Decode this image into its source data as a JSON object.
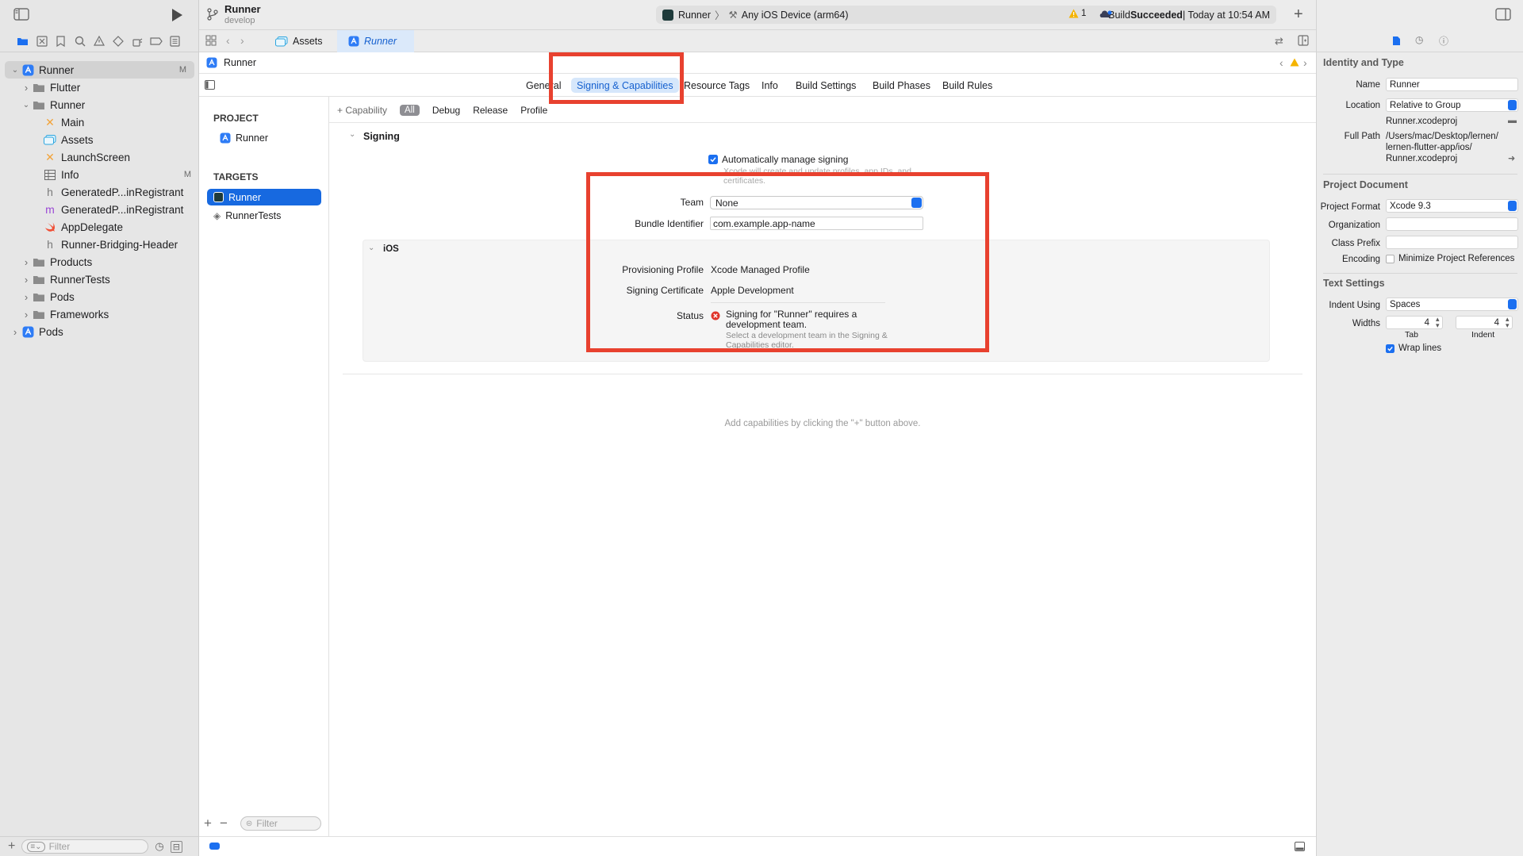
{
  "toolbar": {
    "project_name": "Runner",
    "branch": "develop",
    "scheme": "Runner",
    "device": "Any iOS Device (arm64)",
    "build_prefix": "Build ",
    "build_status": "Succeeded",
    "build_time": " | Today at 10:54 AM",
    "warning_count": "1"
  },
  "tabs": {
    "assets": "Assets",
    "runner": "Runner"
  },
  "jumpbar": {
    "item": "Runner"
  },
  "navigator": {
    "items": [
      {
        "label": "Runner",
        "level": 0,
        "disclosure": "open",
        "icon": "project",
        "badge": "M",
        "selected": true
      },
      {
        "label": "Flutter",
        "level": 1,
        "disclosure": "closed",
        "icon": "folder",
        "badge": ""
      },
      {
        "label": "Runner",
        "level": 1,
        "disclosure": "open",
        "icon": "folder",
        "badge": ""
      },
      {
        "label": "Main",
        "level": 2,
        "disclosure": "",
        "icon": "storyboard",
        "badge": ""
      },
      {
        "label": "Assets",
        "level": 2,
        "disclosure": "",
        "icon": "assets",
        "badge": ""
      },
      {
        "label": "LaunchScreen",
        "level": 2,
        "disclosure": "",
        "icon": "storyboard",
        "badge": ""
      },
      {
        "label": "Info",
        "level": 2,
        "disclosure": "",
        "icon": "plist",
        "badge": "M"
      },
      {
        "label": "GeneratedP...inRegistrant",
        "level": 2,
        "disclosure": "",
        "icon": "header",
        "badge": ""
      },
      {
        "label": "GeneratedP...inRegistrant",
        "level": 2,
        "disclosure": "",
        "icon": "objc",
        "badge": ""
      },
      {
        "label": "AppDelegate",
        "level": 2,
        "disclosure": "",
        "icon": "swift",
        "badge": ""
      },
      {
        "label": "Runner-Bridging-Header",
        "level": 2,
        "disclosure": "",
        "icon": "header",
        "badge": ""
      },
      {
        "label": "Products",
        "level": 1,
        "disclosure": "closed",
        "icon": "folder",
        "badge": ""
      },
      {
        "label": "RunnerTests",
        "level": 1,
        "disclosure": "closed",
        "icon": "folder",
        "badge": ""
      },
      {
        "label": "Pods",
        "level": 1,
        "disclosure": "closed",
        "icon": "folder",
        "badge": ""
      },
      {
        "label": "Frameworks",
        "level": 1,
        "disclosure": "closed",
        "icon": "folder",
        "badge": ""
      },
      {
        "label": "Pods",
        "level": 0,
        "disclosure": "closed",
        "icon": "project",
        "badge": ""
      }
    ],
    "filter_placeholder": "Filter"
  },
  "editor_tabs": {
    "general": "General",
    "signing": "Signing & Capabilities",
    "resource_tags": "Resource Tags",
    "info": "Info",
    "build_settings": "Build Settings",
    "build_phases": "Build Phases",
    "build_rules": "Build Rules"
  },
  "targets_panel": {
    "project_header": "PROJECT",
    "project_item": "Runner",
    "targets_header": "TARGETS",
    "target_runner": "Runner",
    "target_tests": "RunnerTests",
    "filter_placeholder": "Filter"
  },
  "signing": {
    "capability_button": "+ Capability",
    "filters": {
      "all": "All",
      "debug": "Debug",
      "release": "Release",
      "profile": "Profile"
    },
    "section_title": "Signing",
    "auto_manage_label": "Automatically manage signing",
    "auto_manage_sub": "Xcode will create and update profiles, app IDs, and certificates.",
    "team_label": "Team",
    "team_value": "None",
    "bundle_label": "Bundle Identifier",
    "bundle_value": "com.example.app-name",
    "ios_title": "iOS",
    "provisioning_label": "Provisioning Profile",
    "provisioning_value": "Xcode Managed Profile",
    "certificate_label": "Signing Certificate",
    "certificate_value": "Apple Development",
    "status_label": "Status",
    "status_value": "Signing for \"Runner\" requires a development team.",
    "status_sub": "Select a development team in the Signing & Capabilities editor.",
    "capabilities_hint": "Add capabilities by clicking the \"+\" button above."
  },
  "inspector": {
    "identity_header": "Identity and Type",
    "name_label": "Name",
    "name_value": "Runner",
    "location_label": "Location",
    "location_value": "Relative to Group",
    "file_name": "Runner.xcodeproj",
    "fullpath_label": "Full Path",
    "fullpath_value_1": "/Users/mac/Desktop/lernen/",
    "fullpath_value_2": "lernen-flutter-app/ios/",
    "fullpath_value_3": "Runner.xcodeproj",
    "project_doc_header": "Project Document",
    "format_label": "Project Format",
    "format_value": "Xcode 9.3",
    "org_label": "Organization",
    "prefix_label": "Class Prefix",
    "encoding_label": "Encoding",
    "encoding_value": "Minimize Project References",
    "text_settings_header": "Text Settings",
    "indent_label": "Indent Using",
    "indent_value": "Spaces",
    "widths_label": "Widths",
    "tab_value": "4",
    "indent_width_value": "4",
    "tab_caption": "Tab",
    "indent_caption": "Indent",
    "wrap_label": "Wrap lines"
  },
  "colors": {
    "accent": "#1b6ff0",
    "highlight_box": "#e8412f",
    "selection": "#1769e0",
    "error": "#e0352b",
    "warning": "#f5b400"
  }
}
